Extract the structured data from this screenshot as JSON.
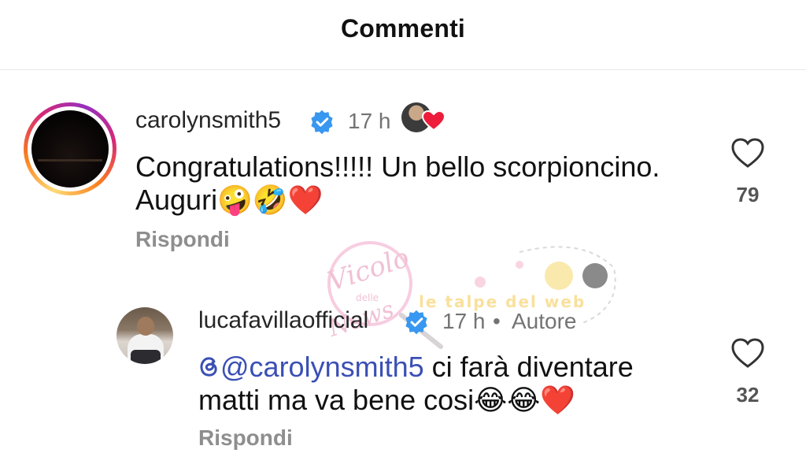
{
  "header": {
    "title": "Commenti"
  },
  "comments": [
    {
      "username": "carolynsmith5",
      "time": "17 h",
      "text_line1": "Congratulations!!!!! Un bello scorpioncino.",
      "text_line2": "Auguri🤪🤣❤️",
      "reply_label": "Rispondi",
      "likes": "79"
    },
    {
      "username": "lucafavillaofficial",
      "time": "17 h",
      "author_tag": "Autore",
      "separator": "•",
      "mention": "@carolynsmith5",
      "text_line1_rest": " ci farà diventare",
      "text_line2": "matti ma va bene cosi😂😂❤️",
      "reply_label": "Rispondi",
      "likes": "32"
    }
  ],
  "watermark": {
    "line1": "Vicolo",
    "line2": "delle",
    "line3": "News",
    "tagline": "le talpe del web"
  },
  "icons": {
    "verified": "verified-badge-icon",
    "heart": "heart-icon",
    "threads": "threads-icon",
    "author_liked": "author-liked-heart-icon"
  },
  "colors": {
    "verified": "#3897f0",
    "mention": "#3a4fb5",
    "heart_red": "#ed1c3a"
  }
}
